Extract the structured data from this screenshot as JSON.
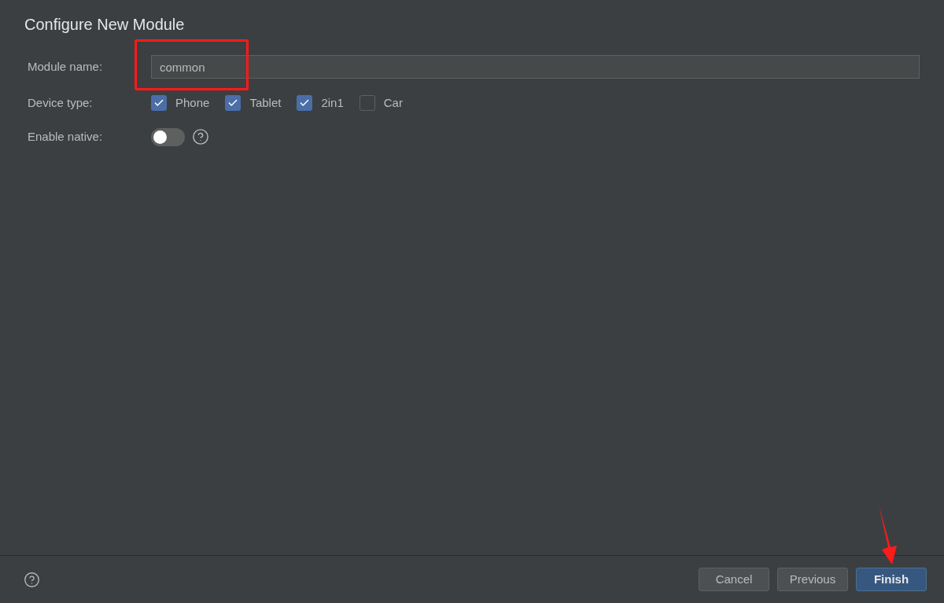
{
  "title": "Configure New Module",
  "module_name": {
    "label": "Module name:",
    "value": "common"
  },
  "device_type": {
    "label": "Device type:",
    "options": [
      {
        "label": "Phone",
        "checked": true
      },
      {
        "label": "Tablet",
        "checked": true
      },
      {
        "label": "2in1",
        "checked": true
      },
      {
        "label": "Car",
        "checked": false
      }
    ]
  },
  "enable_native": {
    "label": "Enable native:",
    "on": false
  },
  "buttons": [
    {
      "label": "Cancel",
      "kind": "default"
    },
    {
      "label": "Previous",
      "kind": "default"
    },
    {
      "label": "Finish",
      "kind": "primary"
    }
  ]
}
